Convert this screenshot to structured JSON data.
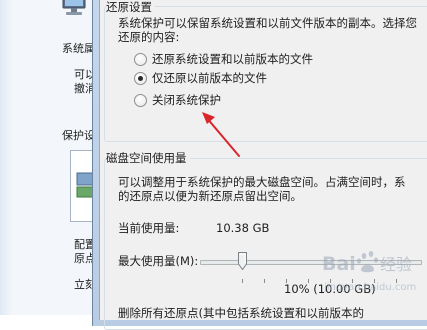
{
  "background_window": {
    "labels": [
      "系统属",
      "可以",
      "撤消",
      "保护设",
      "配置",
      "原点",
      "立刻"
    ]
  },
  "dialog": {
    "restore_settings": {
      "heading": "还原设置",
      "description_line1": "系统保护可以保留系统设置和以前文件版本的副本。选择您",
      "description_line2": "还原的内容:",
      "options": [
        {
          "label": "还原系统设置和以前版本的文件",
          "checked": false
        },
        {
          "label": "仅还原以前版本的文件",
          "checked": true
        },
        {
          "label": "关闭系统保护",
          "checked": false
        }
      ]
    },
    "disk_space": {
      "heading": "磁盘空间使用量",
      "description_line1": "可以调整用于系统保护的最大磁盘空间。占满空间时，系",
      "description_line2": "的还原点以便为新还原点留出空间。",
      "current_usage_label": "当前使用量:",
      "current_usage_value": "10.38 GB",
      "max_usage_label": "最大使用量(M):",
      "max_usage_percent": 10,
      "max_usage_readout": "10% (10.00 GB)",
      "delete_text_partial": "删除所有还原点(其中包括系统设置和以前版本的"
    }
  },
  "annotation": {
    "arrow_color": "#d9262b"
  },
  "watermark": {
    "text": "Baidu 经验",
    "url_text": "jingyan.baidu.com"
  }
}
